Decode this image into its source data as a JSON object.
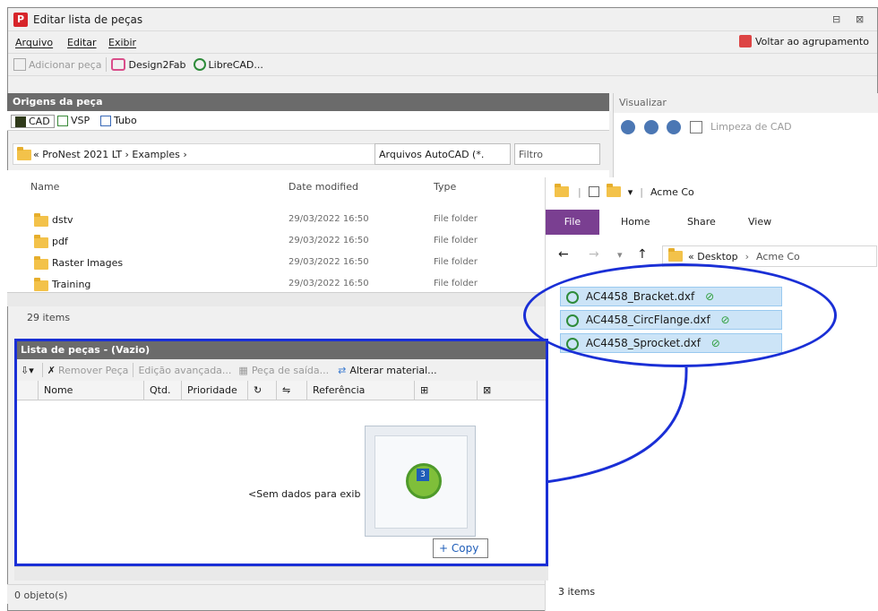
{
  "window": {
    "title": "Editar lista de peças",
    "menu": [
      "Arquivo",
      "Editar",
      "Exibir"
    ],
    "voltar_label": "Voltar ao agrupamento"
  },
  "toolbar": {
    "add_part": "Adicionar peça",
    "design2fab": "Design2Fab",
    "librecad": "LibreCAD..."
  },
  "origens": {
    "header": "Origens da peça",
    "tabs": [
      "CAD",
      "VSP",
      "Tubo"
    ],
    "path": "« ProNest 2021 LT ›  Examples  ›",
    "filetype": "Arquivos AutoCAD (*.",
    "filter_placeholder": "Filtro",
    "columns": [
      "Name",
      "Date modified",
      "Type"
    ],
    "rows": [
      {
        "name": "dstv",
        "date": "29/03/2022 16:50",
        "type": "File folder"
      },
      {
        "name": "pdf",
        "date": "29/03/2022 16:50",
        "type": "File folder"
      },
      {
        "name": "Raster Images",
        "date": "29/03/2022 16:50",
        "type": "File folder"
      },
      {
        "name": "Training",
        "date": "29/03/2022 16:50",
        "type": "File folder"
      }
    ],
    "items_count": "29 items"
  },
  "visualizar": {
    "header": "Visualizar",
    "cleanup": "Limpeza de CAD"
  },
  "explorer": {
    "title": "Acme Co",
    "ribbon": [
      "File",
      "Home",
      "Share",
      "View"
    ],
    "path_desktop": "« Desktop",
    "path_folder": "Acme Co",
    "files": [
      "AC4458_Bracket.dxf",
      "AC4458_CircFlange.dxf",
      "AC4458_Sprocket.dxf"
    ],
    "count": "3 items"
  },
  "lista": {
    "header": "Lista de peças  -  (Vazio)",
    "remove": "Remover Peça",
    "advanced": "Edição avançada...",
    "output_part": "Peça de saída...",
    "change_material": "Alterar material...",
    "columns": [
      "Nome",
      "Qtd.",
      "Prioridade",
      "Referência"
    ],
    "empty_message": "<Sem dados para exib",
    "copy_label": "+ Copy",
    "drag_number": "3"
  },
  "status": {
    "objects": "0 objeto(s)"
  },
  "colors": {
    "highlight_blue": "#1a2fd6",
    "explorer_file_tab": "#7a3f91",
    "selection": "#cce4f7"
  }
}
